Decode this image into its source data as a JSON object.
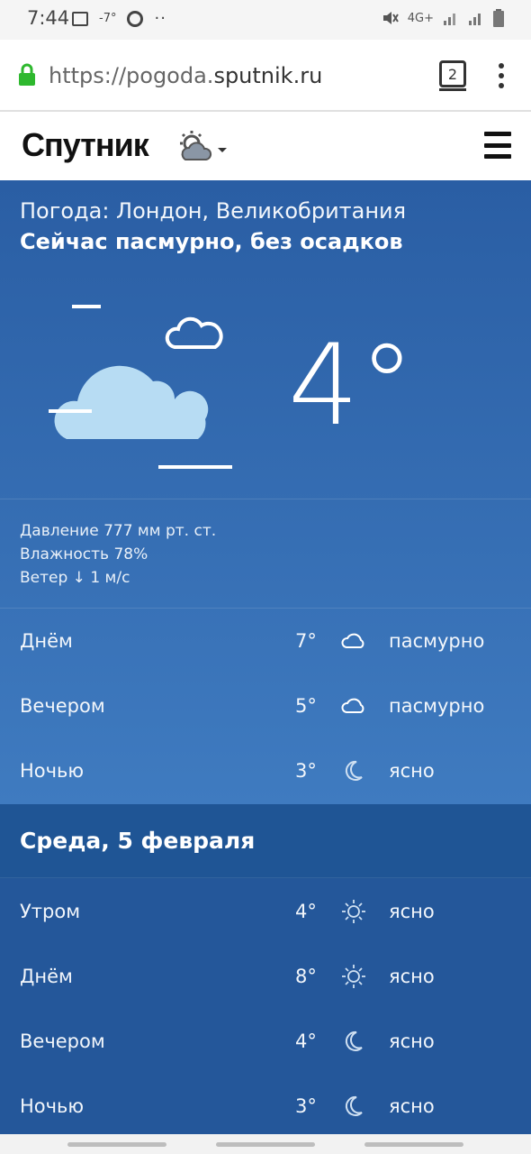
{
  "status_bar": {
    "time": "7:44",
    "temp_indicator": "-7°",
    "network": "4G+",
    "left_icons": [
      "image-icon",
      "dnd-icon",
      "more-dots"
    ],
    "right_icons": [
      "mute-icon",
      "signal-icon",
      "battery-icon"
    ]
  },
  "browser": {
    "url_prefix": "https://pogoda.",
    "url_domain": "sputnik.ru",
    "tab_count": "2",
    "accent": "#2eb82e"
  },
  "site": {
    "logo": "Спутник"
  },
  "current": {
    "location": "Погода: Лондон, Великобритания",
    "summary": "Сейчас пасмурно, без осадков",
    "temperature": "4°",
    "pressure": "Давление 777 мм рт. ст.",
    "humidity": "Влажность 78%",
    "wind": "Ветер ↓ 1 м/с"
  },
  "today": [
    {
      "label": "Днём",
      "temp": "7°",
      "icon": "cloud-icon",
      "cond": "пасмурно"
    },
    {
      "label": "Вечером",
      "temp": "5°",
      "icon": "cloud-icon",
      "cond": "пасмурно"
    },
    {
      "label": "Ночью",
      "temp": "3°",
      "icon": "moon-icon",
      "cond": "ясно"
    }
  ],
  "next_day": {
    "title": "Среда, 5 февраля",
    "rows": [
      {
        "label": "Утром",
        "temp": "4°",
        "icon": "sun-icon",
        "cond": "ясно"
      },
      {
        "label": "Днём",
        "temp": "8°",
        "icon": "sun-icon",
        "cond": "ясно"
      },
      {
        "label": "Вечером",
        "temp": "4°",
        "icon": "moon-icon",
        "cond": "ясно"
      },
      {
        "label": "Ночью",
        "temp": "3°",
        "icon": "moon-icon",
        "cond": "ясно"
      }
    ]
  }
}
